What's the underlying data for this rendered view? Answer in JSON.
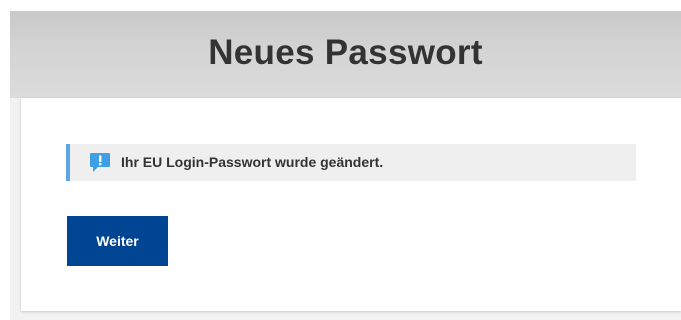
{
  "header": {
    "title": "Neues Passwort"
  },
  "message": {
    "icon": "info-speech-bubble-icon",
    "text": "Ihr EU Login-Passwort wurde geändert."
  },
  "actions": {
    "continue_label": "Weiter"
  },
  "colors": {
    "header_background": "#d4d4d4",
    "button_background": "#004494",
    "message_accent": "#5aa6e6",
    "icon_blue": "#3f9fe6"
  }
}
